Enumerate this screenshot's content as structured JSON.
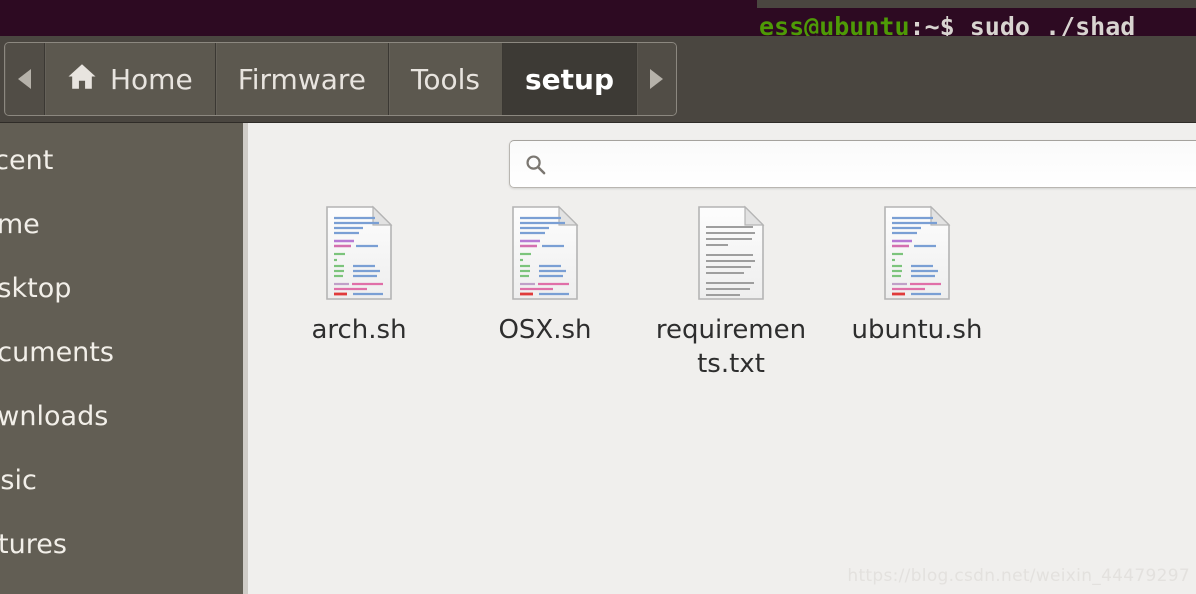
{
  "terminal": {
    "prompt_user": "ess@ubuntu",
    "prompt_sep": ":~$ ",
    "command": "sudo ./shad",
    "full_line": "ess@ubuntu:~$ sudo ./shad",
    "colors": {
      "background": "#2d0a22",
      "prompt": "#4e9a06",
      "text": "#d8d4d0"
    }
  },
  "pathbar": {
    "scroll_left_icon": "triangle-left-icon",
    "scroll_right_icon": "triangle-right-icon",
    "home_icon": "home-icon",
    "crumbs": [
      {
        "label": "Home",
        "active": false,
        "has_icon": true
      },
      {
        "label": "Firmware",
        "active": false,
        "has_icon": false
      },
      {
        "label": "Tools",
        "active": false,
        "has_icon": false
      },
      {
        "label": "setup",
        "active": true,
        "has_icon": false
      }
    ]
  },
  "sidebar": {
    "background": "#625e54",
    "items": [
      {
        "label": "Recent",
        "icon": "clock-icon"
      },
      {
        "label": "Home",
        "icon": "home-icon"
      },
      {
        "label": "Desktop",
        "icon": "desktop-icon"
      },
      {
        "label": "Documents",
        "icon": "documents-icon"
      },
      {
        "label": "Downloads",
        "icon": "downloads-icon"
      },
      {
        "label": "Music",
        "icon": "music-icon"
      },
      {
        "label": "Pictures",
        "icon": "pictures-icon"
      }
    ]
  },
  "search": {
    "value": "",
    "placeholder": "",
    "icon": "search-icon"
  },
  "files": [
    {
      "name": "arch.sh",
      "type": "shell-script",
      "icon": "script-file-icon"
    },
    {
      "name": "OSX.sh",
      "type": "shell-script",
      "icon": "script-file-icon"
    },
    {
      "name": "requirements.txt",
      "type": "text",
      "icon": "text-file-icon"
    },
    {
      "name": "ubuntu.sh",
      "type": "shell-script",
      "icon": "script-file-icon"
    }
  ],
  "watermark": {
    "text": "https://blog.csdn.net/weixin_44479297"
  },
  "theme": {
    "panel_dark": "#2d0a22",
    "toolbar": "#4a4640",
    "sidebar": "#625e54",
    "file_pane": "#f0efed",
    "crumb_active": "#3d3a35"
  }
}
